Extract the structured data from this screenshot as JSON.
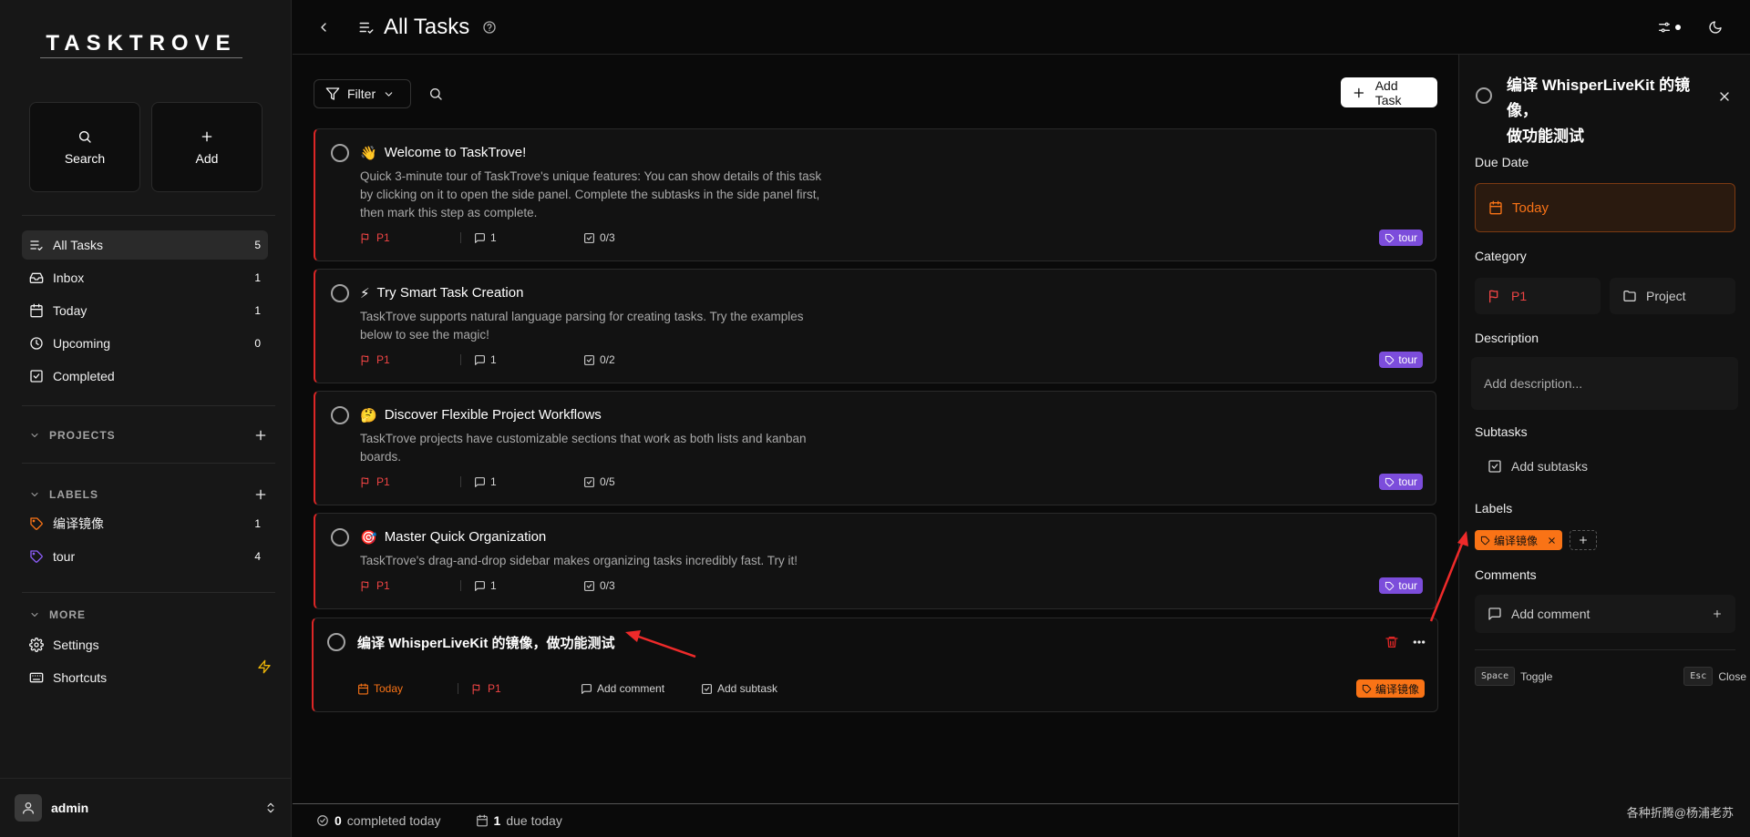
{
  "sidebar": {
    "logo": "TASKTROVE",
    "quick": {
      "search": "Search",
      "add": "Add"
    },
    "nav": [
      {
        "label": "All Tasks",
        "count": "5"
      },
      {
        "label": "Inbox",
        "count": "1"
      },
      {
        "label": "Today",
        "count": "1"
      },
      {
        "label": "Upcoming",
        "count": "0"
      },
      {
        "label": "Completed",
        "count": ""
      }
    ],
    "projects_heading": "PROJECTS",
    "labels_heading": "LABELS",
    "labels": [
      {
        "label": "编译镜像",
        "count": "1",
        "color": "#f97316"
      },
      {
        "label": "tour",
        "count": "4",
        "color": "#8b5cf6"
      }
    ],
    "more_heading": "MORE",
    "more": [
      {
        "label": "Settings"
      },
      {
        "label": "Shortcuts"
      }
    ],
    "user": "admin"
  },
  "header": {
    "title": "All Tasks"
  },
  "toolbar": {
    "filter": "Filter",
    "add_task": "Add Task"
  },
  "tasks": [
    {
      "emoji": "👋",
      "title": "Welcome to TaskTrove!",
      "description": "Quick 3-minute tour of TaskTrove's unique features: You can show details of this task by clicking on it to open the side panel. Complete the subtasks in the side panel first, then mark this step as complete.",
      "priority": "P1",
      "comments": "1",
      "subtasks": "0/3",
      "tag": "tour"
    },
    {
      "emoji": "⚡",
      "title": "Try Smart Task Creation",
      "description": "TaskTrove supports natural language parsing for creating tasks. Try the examples below to see the magic!",
      "priority": "P1",
      "comments": "1",
      "subtasks": "0/2",
      "tag": "tour"
    },
    {
      "emoji": "🤔",
      "title": "Discover Flexible Project Workflows",
      "description": "TaskTrove projects have customizable sections that work as both lists and kanban boards.",
      "priority": "P1",
      "comments": "1",
      "subtasks": "0/5",
      "tag": "tour"
    },
    {
      "emoji": "🎯",
      "title": "Master Quick Organization",
      "description": "TaskTrove's drag-and-drop sidebar makes organizing tasks incredibly fast. Try it!",
      "priority": "P1",
      "comments": "1",
      "subtasks": "0/3",
      "tag": "tour"
    }
  ],
  "selected_task": {
    "title": "编译 WhisperLiveKit 的镜像，做功能测试",
    "due": "Today",
    "priority": "P1",
    "add_comment": "Add comment",
    "add_subtask": "Add subtask",
    "tag": "编译镜像"
  },
  "footer": {
    "completed_count": "0",
    "completed_text": "completed today",
    "due_count": "1",
    "due_text": "due today"
  },
  "panel": {
    "title_line1": "编译 WhisperLiveKit 的镜像，",
    "title_line2": "做功能测试",
    "due_date_label": "Due Date",
    "due_value": "Today",
    "category_label": "Category",
    "priority": "P1",
    "project": "Project",
    "description_label": "Description",
    "description_placeholder": "Add description...",
    "subtasks_label": "Subtasks",
    "add_subtasks": "Add subtasks",
    "labels_label": "Labels",
    "label_chip": "编译镜像",
    "comments_label": "Comments",
    "add_comment": "Add comment",
    "kbd_space": "Space",
    "toggle": "Toggle",
    "kbd_esc": "Esc",
    "close": "Close"
  },
  "watermark": "各种折腾@杨浦老苏",
  "colors": {
    "accent_red": "#ef4444",
    "accent_orange": "#f97316",
    "tour_purple": "#7c4ddb"
  }
}
